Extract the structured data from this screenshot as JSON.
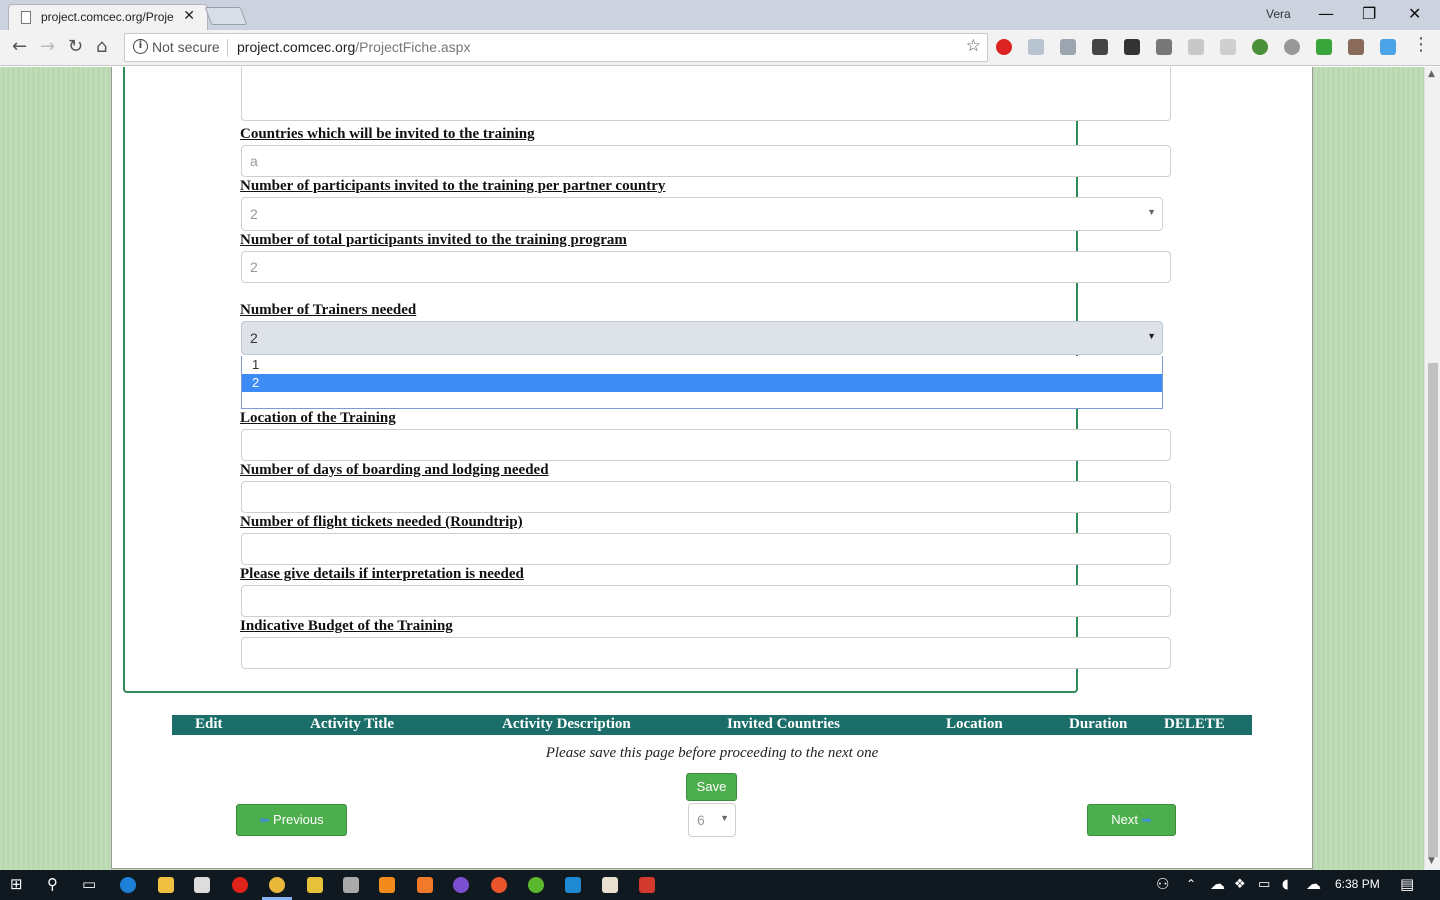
{
  "browser": {
    "tab_title": "project.comcec.org/Proje",
    "tab_close": "✕",
    "profile_name": "Vera",
    "not_secure": "Not secure",
    "url_host": "project.comcec.org",
    "url_path": "/ProjectFiche.aspx",
    "window_controls": {
      "minimize": "—",
      "restore": "❐",
      "close": "✕"
    }
  },
  "form": {
    "countries_label": "Countries which will be invited to the training",
    "countries_value": "a",
    "participants_per_country_label": "Number of participants invited to the training per partner country",
    "participants_per_country_value": "2",
    "total_participants_label": "Number of total participants invited to the training program",
    "total_participants_value": "2",
    "trainers_label": "Number of Trainers needed",
    "trainers_value": "2",
    "trainers_options": [
      "1",
      "2"
    ],
    "location_label": "Location of the Training",
    "boarding_days_label": "Number of days of boarding and lodging needed",
    "flight_tickets_label": "Number of flight tickets needed (Roundtrip)",
    "interpretation_label": "Please give details if interpretation is needed",
    "budget_label": "Indicative Budget of the Training"
  },
  "activity_table": {
    "columns": [
      "Edit",
      "Activity Title",
      "Activity Description",
      "Invited Countries",
      "Location",
      "Duration",
      "DELETE"
    ]
  },
  "footer": {
    "save_note": "Please save this page before proceeding to the next one",
    "save_label": "Save",
    "previous_label": "Previous",
    "next_label": "Next",
    "page_number": "6"
  },
  "taskbar": {
    "time": "6:38 PM"
  },
  "colors": {
    "page_background": "#b9d8b0",
    "form_border": "#2e8b57",
    "table_header": "#1b6e6a",
    "button_green": "#4cae4c",
    "dropdown_selected": "#3d8cf5"
  }
}
